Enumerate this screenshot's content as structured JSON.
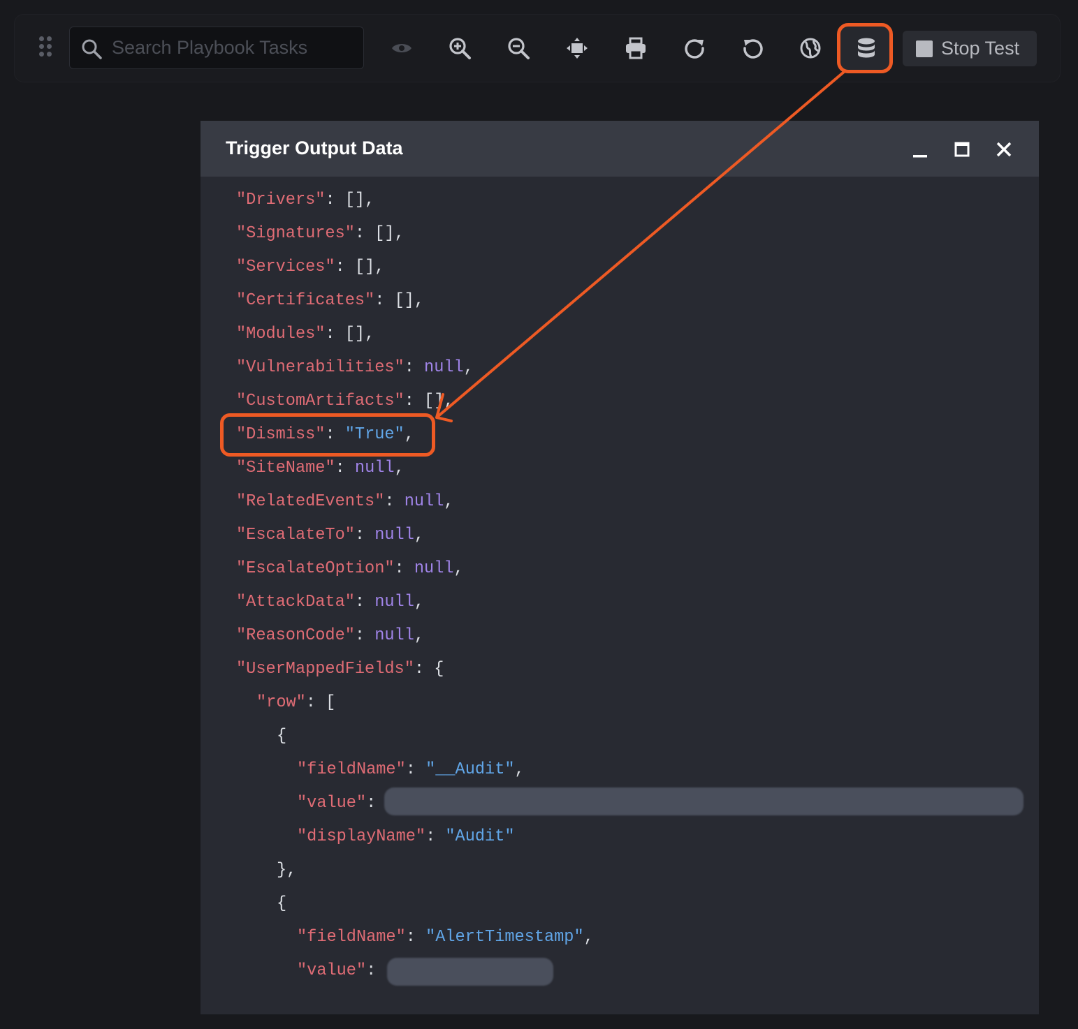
{
  "toolbar": {
    "search_placeholder": "Search Playbook Tasks",
    "stop_label": "Stop Test",
    "tools": [
      "eye-icon",
      "zoom-in-icon",
      "zoom-out-icon",
      "fit-screen-icon",
      "print-icon",
      "rotate-clockwise-icon",
      "rotate-counterclockwise-icon",
      "globe-icon",
      "database-icon"
    ]
  },
  "modal": {
    "title": "Trigger Output Data"
  },
  "code": {
    "drivers": "\"Drivers\"",
    "signatures": "\"Signatures\"",
    "services": "\"Services\"",
    "certificates": "\"Certificates\"",
    "modules": "\"Modules\"",
    "vulnerabilities": "\"Vulnerabilities\"",
    "customartifacts": "\"CustomArtifacts\"",
    "dismiss": "\"Dismiss\"",
    "dismiss_value": "\"True\"",
    "sitename": "\"SiteName\"",
    "relatedevents": "\"RelatedEvents\"",
    "escalateto": "\"EscalateTo\"",
    "escalateoption": "\"EscalateOption\"",
    "attackdata": "\"AttackData\"",
    "reasoncode": "\"ReasonCode\"",
    "usermappedfields": "\"UserMappedFields\"",
    "row": "\"row\"",
    "fieldname": "\"fieldName\"",
    "value": "\"value\"",
    "displayname": "\"displayName\"",
    "audit_fieldname_value": "\"__Audit\"",
    "audit_displayname_value": "\"Audit\"",
    "alerttimestamp_value": "\"AlertTimestamp\"",
    "empty_array": "[]",
    "null": "null",
    "comma": ",",
    "colon": ": ",
    "open_brace": "{",
    "open_bracket": "[",
    "close_brace_comma": "},"
  },
  "colors": {
    "accent": "#ee5a24",
    "key": "#e06c75",
    "null": "#a084e8",
    "string": "#61a6e8"
  }
}
